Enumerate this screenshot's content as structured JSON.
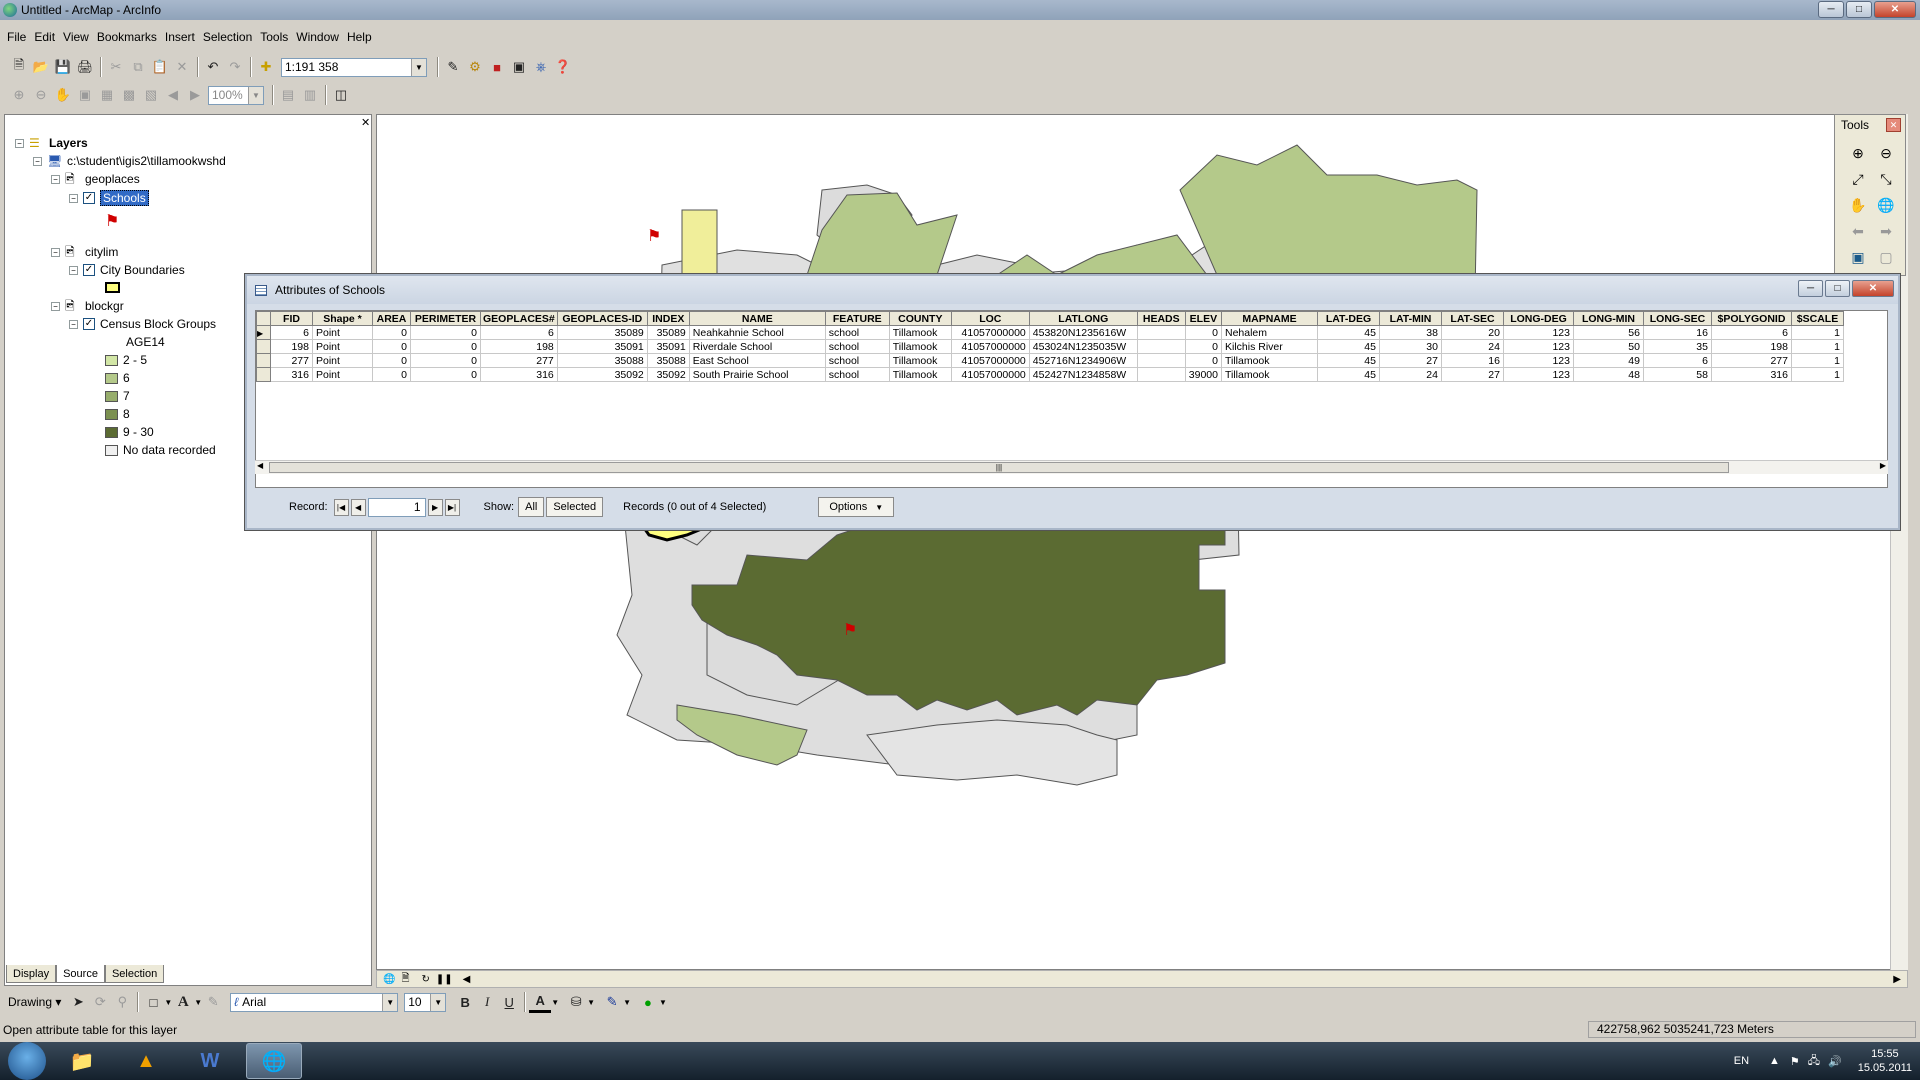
{
  "window": {
    "title": "Untitled - ArcMap - ArcInfo"
  },
  "menu": [
    "File",
    "Edit",
    "View",
    "Bookmarks",
    "Insert",
    "Selection",
    "Tools",
    "Window",
    "Help"
  ],
  "standard_toolbar": {
    "scale": "1:191 358"
  },
  "layout_toolbar": {
    "zoom": "100%"
  },
  "toc": {
    "root": "Layers",
    "path": "c:\\student\\igis2\\tillamookwshd",
    "groups": [
      {
        "name": "geoplaces",
        "layer": "Schools"
      },
      {
        "name": "citylim",
        "layer": "City Boundaries"
      },
      {
        "name": "blockgr",
        "layer": "Census Block Groups",
        "field": "AGE14",
        "classes": [
          {
            "label": "2 - 5",
            "color": "#d2e6a6"
          },
          {
            "label": "6",
            "color": "#b4c98a"
          },
          {
            "label": "7",
            "color": "#97ad6c"
          },
          {
            "label": "8",
            "color": "#7b9050"
          },
          {
            "label": "9 - 30",
            "color": "#5b6b32"
          },
          {
            "label": "No data recorded",
            "color": "#f0f0f0"
          }
        ]
      }
    ],
    "tabs": [
      "Display",
      "Source",
      "Selection"
    ]
  },
  "tools_panel": {
    "title": "Tools"
  },
  "attr_table": {
    "title": "Attributes of Schools",
    "columns": [
      "FID",
      "Shape *",
      "AREA",
      "PERIMETER",
      "GEOPLACES#",
      "GEOPLACES-ID",
      "INDEX",
      "NAME",
      "FEATURE",
      "COUNTY",
      "LOC",
      "LATLONG",
      "HEADS",
      "ELEV",
      "MAPNAME",
      "LAT-DEG",
      "LAT-MIN",
      "LAT-SEC",
      "LONG-DEG",
      "LONG-MIN",
      "LONG-SEC",
      "$POLYGONID",
      "$SCALE"
    ],
    "rows": [
      [
        "6",
        "Point",
        "0",
        "0",
        "6",
        "35089",
        "35089",
        "Neahkahnie School",
        "school",
        "Tillamook",
        "41057000000",
        "453820N1235616W",
        "",
        "0",
        "Nehalem",
        "45",
        "38",
        "20",
        "123",
        "56",
        "16",
        "6",
        "1"
      ],
      [
        "198",
        "Point",
        "0",
        "0",
        "198",
        "35091",
        "35091",
        "Riverdale School",
        "school",
        "Tillamook",
        "41057000000",
        "453024N1235035W",
        "",
        "0",
        "Kilchis River",
        "45",
        "30",
        "24",
        "123",
        "50",
        "35",
        "198",
        "1"
      ],
      [
        "277",
        "Point",
        "0",
        "0",
        "277",
        "35088",
        "35088",
        "East School",
        "school",
        "Tillamook",
        "41057000000",
        "452716N1234906W",
        "",
        "0",
        "Tillamook",
        "45",
        "27",
        "16",
        "123",
        "49",
        "6",
        "277",
        "1"
      ],
      [
        "316",
        "Point",
        "0",
        "0",
        "316",
        "35092",
        "35092",
        "South Prairie School",
        "school",
        "Tillamook",
        "41057000000",
        "452427N1234858W",
        "",
        "39000",
        "Tillamook",
        "45",
        "24",
        "27",
        "123",
        "48",
        "58",
        "316",
        "1"
      ]
    ],
    "record_label": "Record:",
    "record_value": "1",
    "show_label": "Show:",
    "show_all": "All",
    "show_selected": "Selected",
    "records_status": "Records (0 out of 4 Selected)",
    "options": "Options"
  },
  "drawing_toolbar": {
    "label": "Drawing",
    "font": "Arial",
    "size": "10",
    "bold": "B",
    "italic": "I",
    "underline": "U",
    "text_tool": "A"
  },
  "status": {
    "message": "Open attribute table for this layer",
    "coords": "422758,962  5035241,723 Meters"
  },
  "taskbar": {
    "lang": "EN",
    "time": "15:55",
    "date": "15.05.2011"
  }
}
